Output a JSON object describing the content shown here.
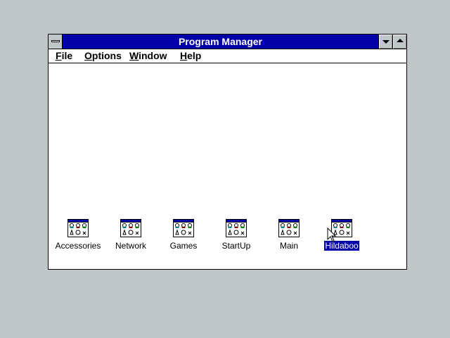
{
  "window": {
    "title": "Program Manager"
  },
  "menubar": {
    "items": [
      {
        "label": "File",
        "accel": "F",
        "rest": "ile"
      },
      {
        "label": "Options",
        "accel": "O",
        "rest": "ptions"
      },
      {
        "label": "Window",
        "accel": "W",
        "rest": "indow"
      },
      {
        "label": "Help",
        "accel": "H",
        "rest": "elp"
      }
    ]
  },
  "groups": [
    {
      "label": "Accessories",
      "selected": false
    },
    {
      "label": "Network",
      "selected": false
    },
    {
      "label": "Games",
      "selected": false
    },
    {
      "label": "StartUp",
      "selected": false
    },
    {
      "label": "Main",
      "selected": false
    },
    {
      "label": "Hildaboo",
      "selected": true
    }
  ],
  "colors": {
    "desktop": "#c0c7c8",
    "titlebar_active": "#0000a8",
    "selection": "#0000a8"
  },
  "icons": {
    "group_icon": "program-group-icon",
    "cursor": "arrow-cursor-icon"
  }
}
